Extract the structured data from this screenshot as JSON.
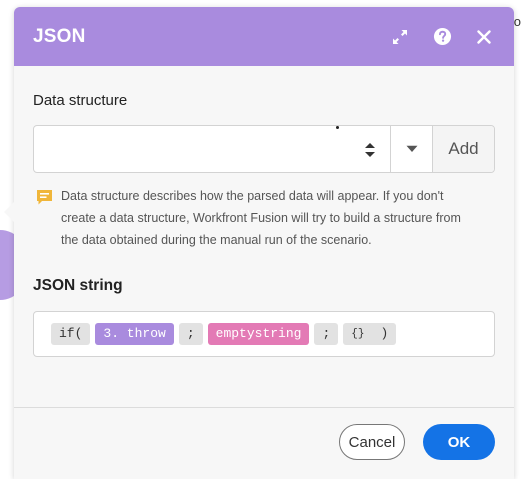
{
  "background": {
    "partial_text": "o"
  },
  "modal": {
    "title": "JSON",
    "header_icons": [
      "expand-icon",
      "help-icon",
      "close-icon"
    ],
    "accent_color": "#a98bde"
  },
  "data_structure": {
    "label": "Data structure",
    "selected_value": "",
    "add_label": "Add",
    "hint": "Data structure describes how the parsed data will appear. If you don't create a data structure, Workfront Fusion will try to build a structure from the data obtained during the manual run of the scenario."
  },
  "json_string": {
    "label": "JSON string",
    "tokens": [
      {
        "text": "if(",
        "kind": "function"
      },
      {
        "text": "3. throw",
        "kind": "variable"
      },
      {
        "text": ";",
        "kind": "separator"
      },
      {
        "text": "emptystring",
        "kind": "keyword"
      },
      {
        "text": ";",
        "kind": "separator"
      },
      {
        "text": "{}",
        "kind": "literal"
      },
      {
        "text": ")",
        "kind": "function"
      }
    ],
    "token_colors": {
      "variable": "#a98bde",
      "keyword": "#e37ab5",
      "function": "#e2e2e2"
    }
  },
  "footer": {
    "cancel_label": "Cancel",
    "ok_label": "OK",
    "ok_color": "#1473e6"
  }
}
